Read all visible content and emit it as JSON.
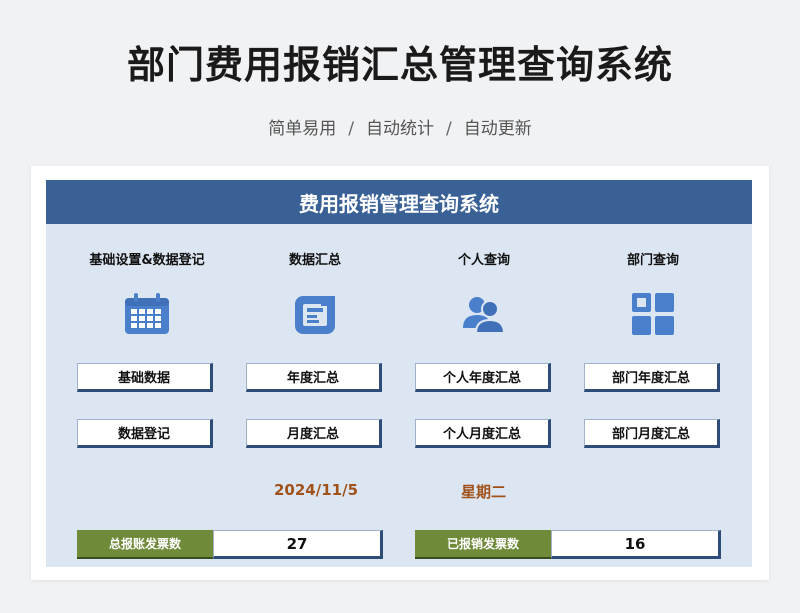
{
  "title": "部门费用报销汇总管理查询系统",
  "subtitle": {
    "part1": "简单易用",
    "part2": "自动统计",
    "part3": "自动更新",
    "separator": "/"
  },
  "panel": {
    "header": "费用报销管理查询系统",
    "columns": [
      {
        "title": "基础设置&数据登记",
        "icon": "calendar-icon",
        "buttons": [
          "基础数据",
          "数据登记"
        ]
      },
      {
        "title": "数据汇总",
        "icon": "folder-summary-icon",
        "buttons": [
          "年度汇总",
          "月度汇总"
        ]
      },
      {
        "title": "个人查询",
        "icon": "users-icon",
        "buttons": [
          "个人年度汇总",
          "个人月度汇总"
        ]
      },
      {
        "title": "部门查询",
        "icon": "grid-icon",
        "buttons": [
          "部门年度汇总",
          "部门月度汇总"
        ]
      }
    ],
    "date": "2024/11/5",
    "weekday": "星期二",
    "stats": [
      {
        "label": "总报账发票数",
        "value": "27"
      },
      {
        "label": "已报销发票数",
        "value": "16"
      }
    ]
  },
  "colors": {
    "header_bg": "#3a6196",
    "panel_bg": "#dce6f2",
    "icon_blue": "#4a7fcb",
    "date_color": "#a0521a",
    "stat_label_bg": "#6f8b3a"
  }
}
